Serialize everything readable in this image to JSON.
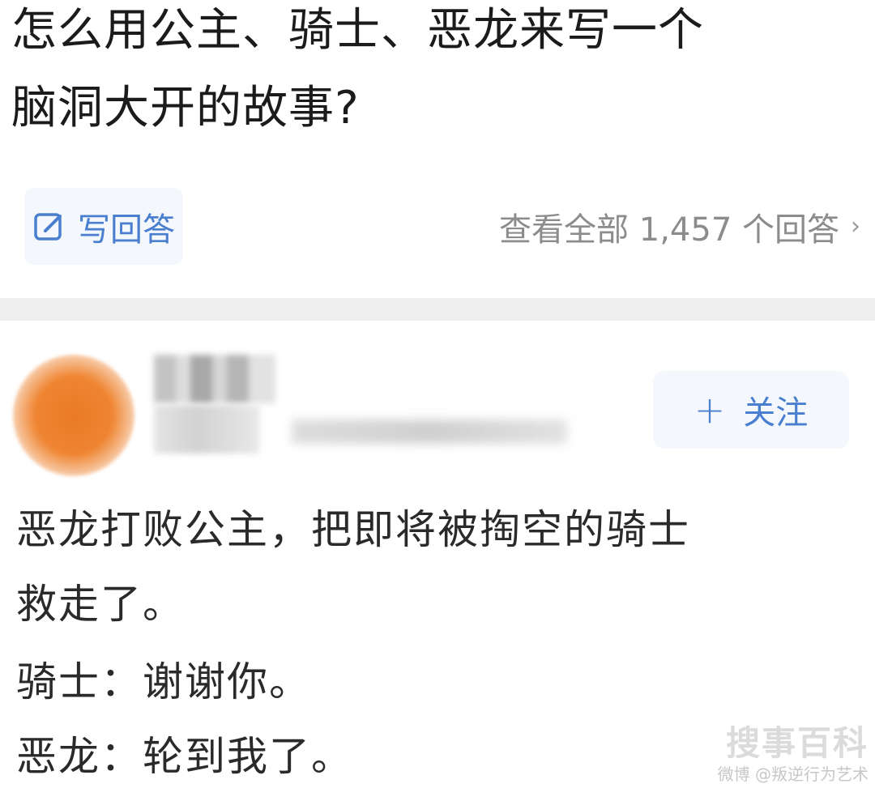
{
  "question": {
    "line1": "怎么用公主、骑士、恶龙来写一个",
    "line2": "脑洞大开的故事?"
  },
  "actions": {
    "write_answer_label": "写回答",
    "view_all_label": "查看全部 1,457 个回答",
    "view_all_chevron": "›",
    "icon": "edit-icon"
  },
  "author": {
    "follow_plus": "+",
    "follow_label": "关注"
  },
  "answer": {
    "lines": [
      "恶龙打败公主，把即将被掏空的骑士",
      "救走了。",
      "骑士：谢谢你。",
      "恶龙：轮到我了。"
    ]
  },
  "watermark": {
    "logo_text": "搜事百科",
    "credit": "微博 @叛逆行为艺术"
  },
  "colors": {
    "accent": "#4a7fd0",
    "muted": "#8c8c8c",
    "divider": "#eeeeee"
  }
}
